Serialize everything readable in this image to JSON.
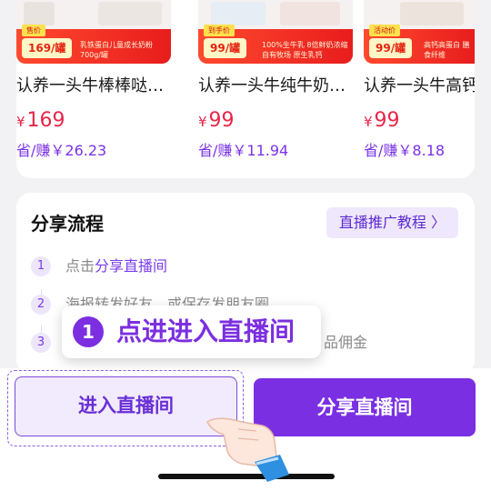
{
  "products": [
    {
      "thumb_tag": "售价",
      "thumb_price": "169/罐",
      "thumb_desc": "乳铁蛋白儿童成长奶粉700g/罐",
      "title": "认养一头牛棒棒哒…",
      "currency": "¥",
      "price": "169",
      "earn": "省/赚￥26.23"
    },
    {
      "thumb_tag": "到手价",
      "thumb_price": "99/罐",
      "thumb_desc": "100%生牛乳 8倍鲜奶浓缩 自有牧场 原生乳钙",
      "title": "认养一头牛纯牛奶…",
      "currency": "¥",
      "price": "99",
      "earn": "省/赚￥11.94"
    },
    {
      "thumb_tag": "活动价",
      "thumb_price": "99/罐",
      "thumb_desc": "高钙高蛋白 膳食纤维",
      "title": "认养一头牛高钙…",
      "currency": "¥",
      "price": "99",
      "earn": "省/赚￥8.18"
    }
  ],
  "flow": {
    "title": "分享流程",
    "tutorial_label": "直播推广教程 〉",
    "steps": [
      {
        "num": "1",
        "prefix": "点击",
        "highlight": "分享直播间",
        "suffix": ""
      },
      {
        "num": "2",
        "prefix": "海报转发好友，或保存发朋友圈",
        "highlight": "",
        "suffix": ""
      },
      {
        "num": "3",
        "prefix": "",
        "highlight": "",
        "suffix": "品佣金"
      }
    ]
  },
  "tooltip": {
    "badge": "1",
    "text": "点进进入直播间"
  },
  "buttons": {
    "enter": "进入直播间",
    "share": "分享直播间"
  },
  "colors": {
    "accent": "#7a2fe3",
    "price": "#e8264a",
    "band": "#e81d1d"
  }
}
